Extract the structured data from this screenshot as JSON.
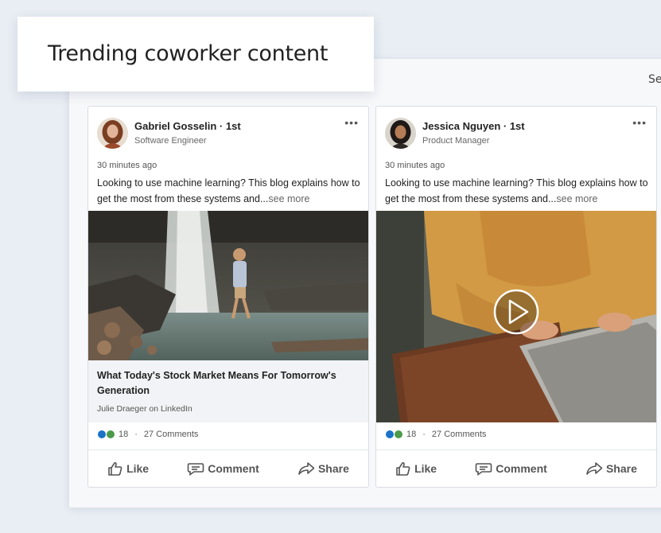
{
  "heading": "Trending coworker content",
  "see_label": "Se",
  "posts": [
    {
      "author": "Gabriel Gosselin · 1st",
      "role": "Software Engineer",
      "time": "30 minutes ago",
      "text": "Looking to use machine learning? This blog explains how to get the most from these systems and...",
      "see_more": "see more",
      "link": {
        "title": "What Today's Stock Market Means For Tomorrow's Generation",
        "source": "Julie Draeger on LinkedIn"
      },
      "reactions": "18",
      "comments": "27 Comments",
      "more": "•••"
    },
    {
      "author": "Jessica Nguyen · 1st",
      "role": "Product Manager",
      "time": "30 minutes ago",
      "text": "Looking to use machine learning? This blog explains how to get the most from these systems and...",
      "see_more": "see more",
      "reactions": "18",
      "comments": "27 Comments",
      "more": "•••"
    }
  ],
  "actions": {
    "like": "Like",
    "comment": "Comment",
    "share": "Share"
  },
  "separator": "·"
}
